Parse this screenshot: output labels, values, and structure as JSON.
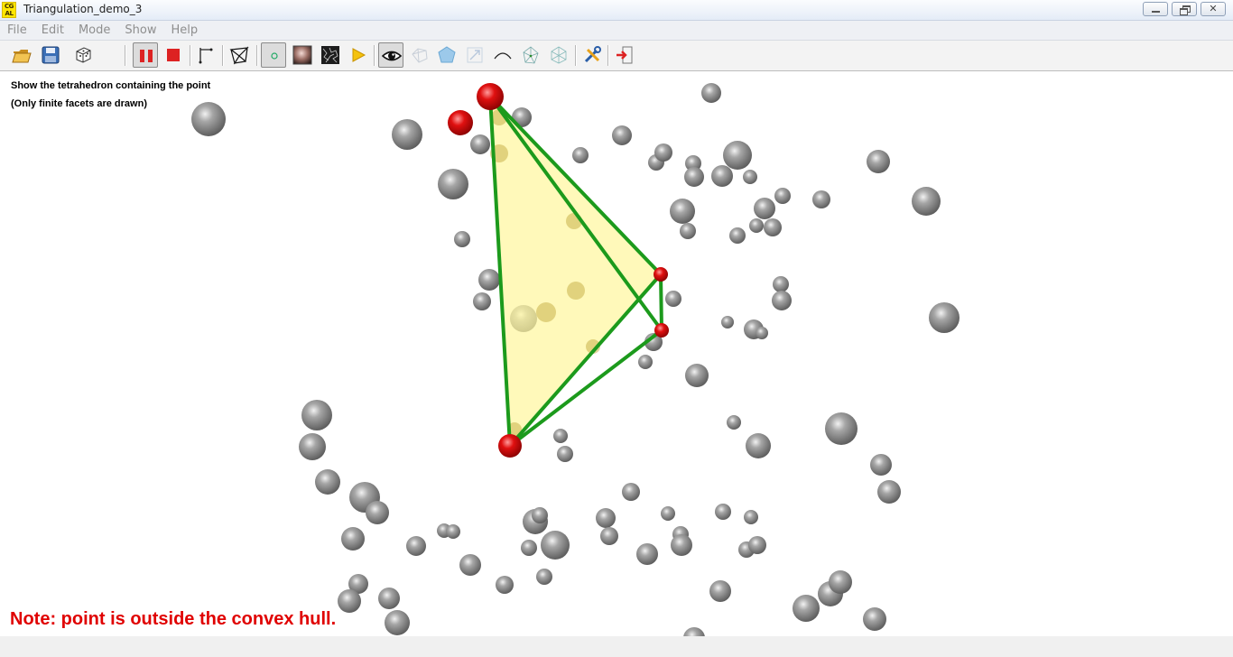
{
  "window": {
    "title": "Triangulation_demo_3",
    "icon_text_top": "CG",
    "icon_text_bottom": "AL"
  },
  "menu": [
    "File",
    "Edit",
    "Mode",
    "Show",
    "Help"
  ],
  "toolbar": {
    "icons": [
      "open-folder-icon",
      "save-icon",
      "dice-icon",
      "pause-icon",
      "stop-icon",
      "segment-icon",
      "triangulation-icon",
      "point-icon",
      "texture-icon",
      "noise-icon",
      "play-icon",
      "eye-icon",
      "polygon-wire-icon",
      "pentagon-icon",
      "arrow-box-icon",
      "curve-icon",
      "voronoi-icon",
      "mesh-icon",
      "tools-icon",
      "exit-icon"
    ]
  },
  "viewer": {
    "info_line1": "Show the tetrahedron containing the point",
    "info_line2": "(Only finite facets are drawn)",
    "note": "Note: point is outside the convex hull."
  },
  "colors": {
    "note": "#e00000",
    "edge": "#1a9a1a",
    "facet": "#fff9a8",
    "sphere": "#8a8a8a",
    "vertex": "#d40000"
  }
}
